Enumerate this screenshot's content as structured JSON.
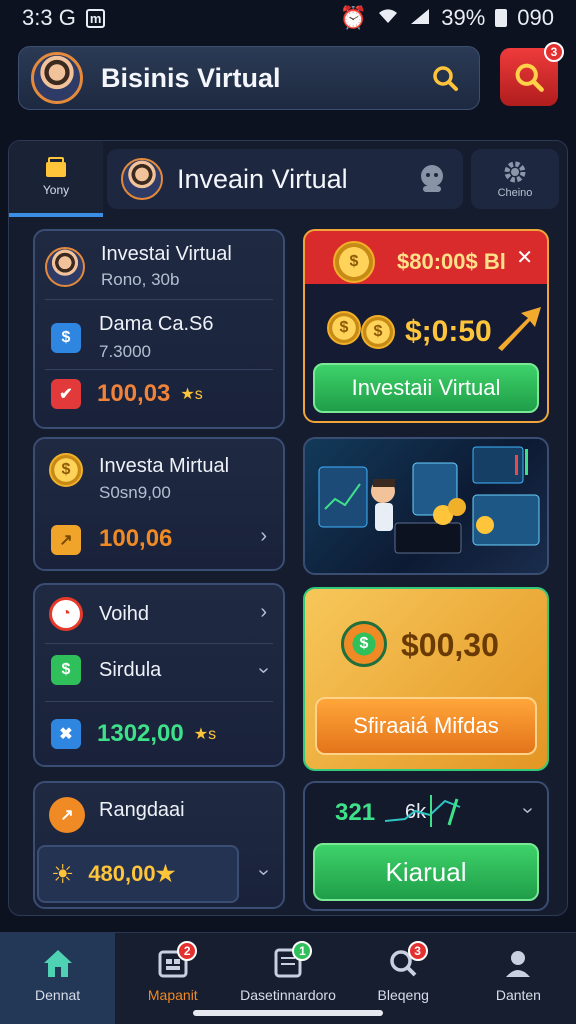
{
  "status_bar": {
    "time": "3:3 G",
    "box_label": "m",
    "battery": "39%",
    "right_value": "090"
  },
  "header": {
    "title": "Bisinis Virtual",
    "notif_count": "3"
  },
  "tabs": {
    "home_label": "Yony",
    "main_title": "Inveain Virtual",
    "settings_label": "Cheino"
  },
  "card1": {
    "items": [
      {
        "label": "Investai Virtual",
        "sub": "Rono, 30b"
      },
      {
        "label": "Dama Ca.S6",
        "sub": "7.3000"
      },
      {
        "amount": "100,03",
        "suffix": "★s"
      }
    ]
  },
  "promo1": {
    "price": "$80:00$ Bl",
    "amount": "$;0:50",
    "button": "Investaii Virtual"
  },
  "card2": {
    "label": "Investa Mirtual",
    "sub": "S0sn9,00",
    "amount": "100,06"
  },
  "card3": {
    "items": [
      {
        "label": "Voihd"
      },
      {
        "label": "Sirdula"
      },
      {
        "amount": "1302,00",
        "suffix": "★s"
      }
    ]
  },
  "promo3": {
    "amount": "$00,30",
    "button": "Sfiraaiá Mifdas"
  },
  "card4": {
    "label": "Rangdaai",
    "amount": "480,00★"
  },
  "market": {
    "v1": "321",
    "v2": "6k",
    "button": "Kiarual"
  },
  "bottom_nav": [
    {
      "label": "Dennat"
    },
    {
      "label": "Mapanit",
      "badge": "2"
    },
    {
      "label": "Dasetinnardoro",
      "badge": "1"
    },
    {
      "label": "Bleqeng",
      "badge": "3"
    },
    {
      "label": "Danten"
    }
  ],
  "colors": {
    "accent": "#3a8ee6",
    "green": "#2fbf5b",
    "gold": "#ffc53a",
    "orange": "#f08a25",
    "red": "#e53030"
  }
}
